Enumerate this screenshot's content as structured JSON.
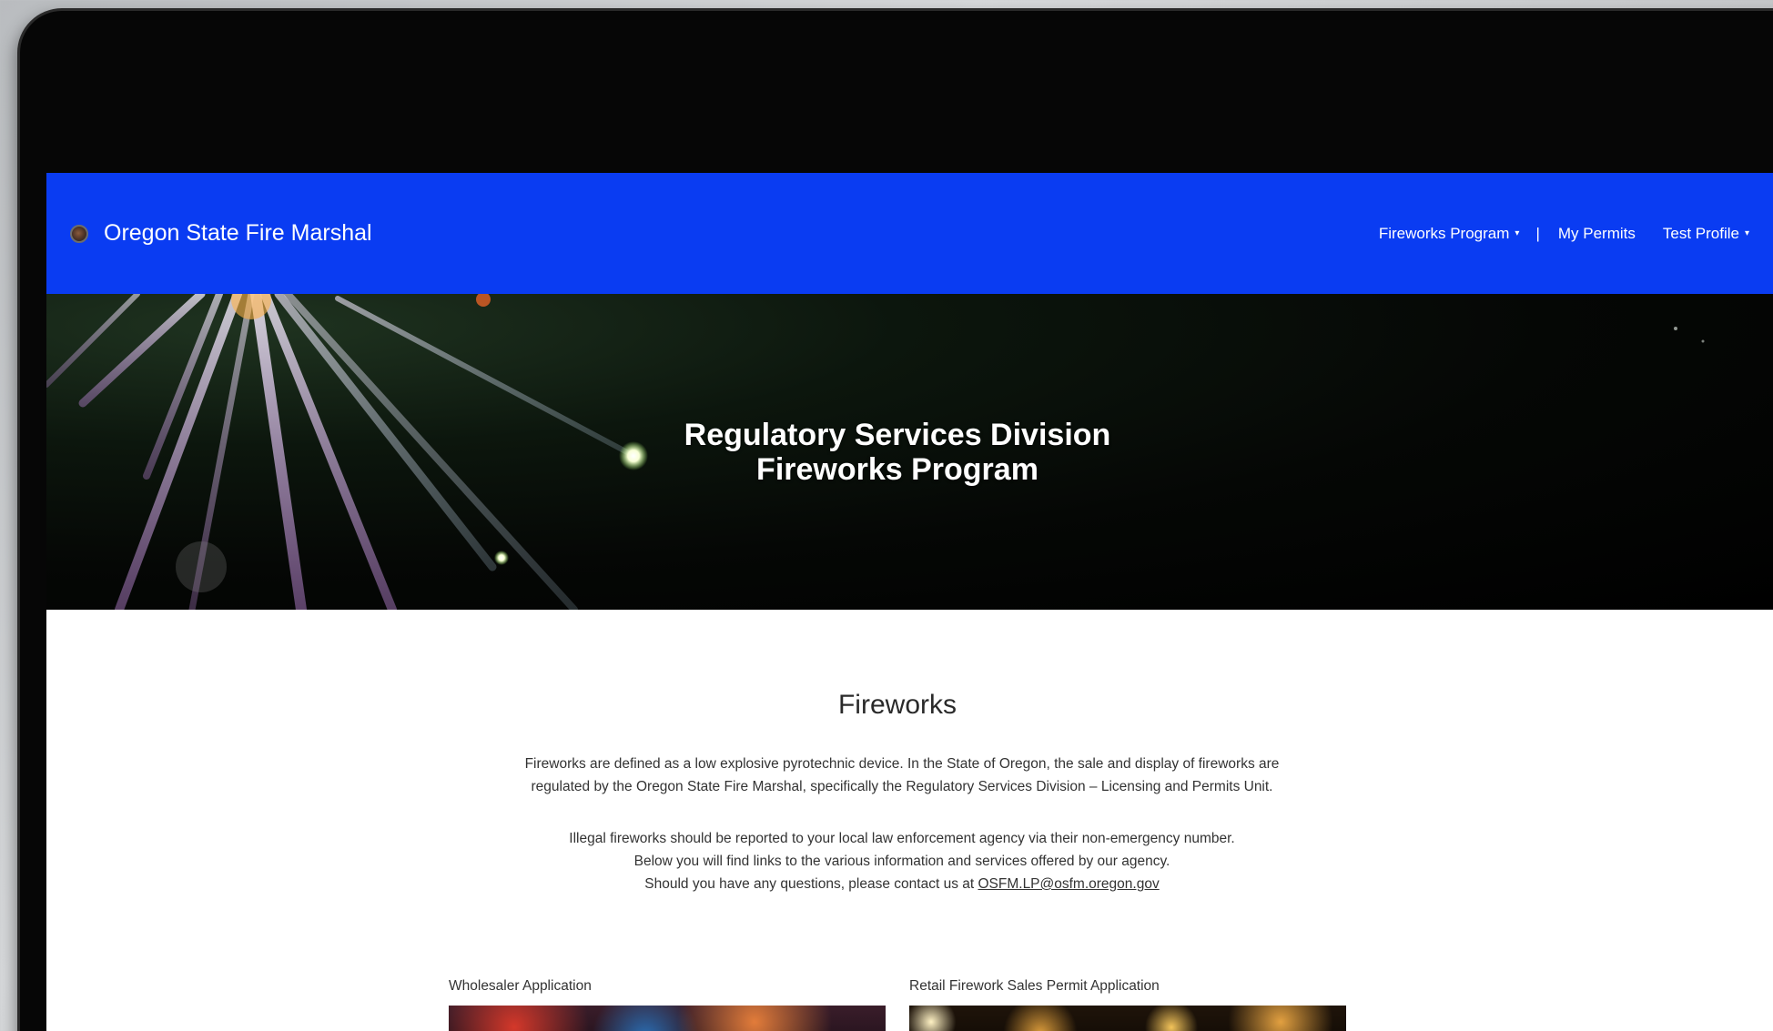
{
  "navbar": {
    "brand_name": "Oregon State Fire Marshal",
    "logo_icon": "seal-icon",
    "links": {
      "fireworks_program": "Fireworks Program",
      "separator": "|",
      "my_permits": "My Permits",
      "test_profile": "Test Profile"
    },
    "caret_icon": "▾",
    "background_color": "#0a3cf2"
  },
  "hero": {
    "title_line1": "Regulatory Services Division",
    "title_line2": "Fireworks Program"
  },
  "main": {
    "title": "Fireworks",
    "intro_line1": "Fireworks are defined as a low explosive pyrotechnic device. In the State of Oregon, the sale and display of fireworks are",
    "intro_line2": "regulated by the Oregon State Fire Marshal, specifically the Regulatory Services Division – Licensing and Permits Unit.",
    "note_line1": "Illegal fireworks should be reported to your local law enforcement agency via their non-emergency number.",
    "note_line2": "Below you will find links to the various information and services offered by our agency.",
    "note_line3_prefix": "Should you have any questions, please contact us at ",
    "contact_email": "OSFM.LP@osfm.oregon.gov"
  },
  "cards": [
    {
      "label": "Wholesaler Application"
    },
    {
      "label": "Retail Firework Sales Permit Application"
    }
  ]
}
